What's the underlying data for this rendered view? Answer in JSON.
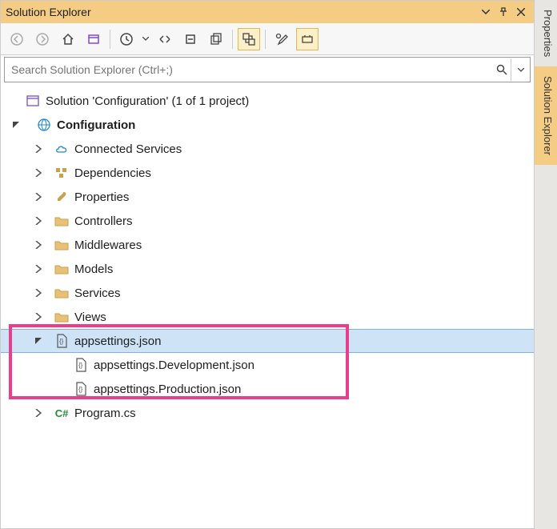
{
  "panel": {
    "title": "Solution Explorer",
    "search_placeholder": "Search Solution Explorer (Ctrl+;)"
  },
  "side_tabs": {
    "properties": "Properties",
    "solution_explorer": "Solution Explorer"
  },
  "tree": {
    "solution": "Solution 'Configuration' (1 of 1 project)",
    "project": "Configuration",
    "connected_services": "Connected Services",
    "dependencies": "Dependencies",
    "properties": "Properties",
    "controllers": "Controllers",
    "middlewares": "Middlewares",
    "models": "Models",
    "services": "Services",
    "views": "Views",
    "appsettings": "appsettings.json",
    "appsettings_dev": "appsettings.Development.json",
    "appsettings_prod": "appsettings.Production.json",
    "program": "Program.cs"
  }
}
